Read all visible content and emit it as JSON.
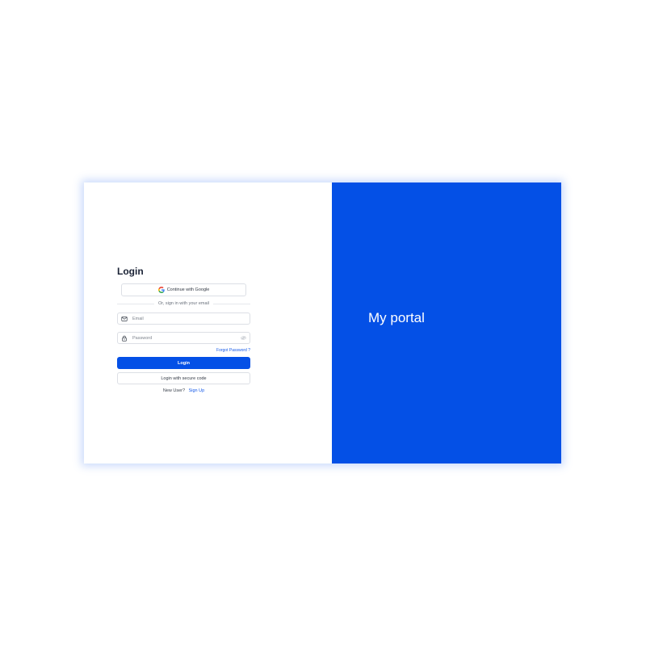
{
  "theme": {
    "accent": "#0450e6",
    "link": "#1559e8"
  },
  "login": {
    "title": "Login",
    "google_label": "Continue with Google",
    "divider_text": "Or, sign in with your email",
    "email": {
      "placeholder": "Email",
      "value": "",
      "icon": "mail-icon"
    },
    "password": {
      "placeholder": "Password",
      "value": "",
      "icon": "lock-icon",
      "toggle_icon": "eye-icon"
    },
    "forgot_label": "Forgot Password ?",
    "login_label": "Login",
    "secure_code_label": "Login with secure code",
    "new_user_text": "New User?",
    "signup_label": "Sign Up"
  },
  "panel": {
    "title": "My portal"
  }
}
